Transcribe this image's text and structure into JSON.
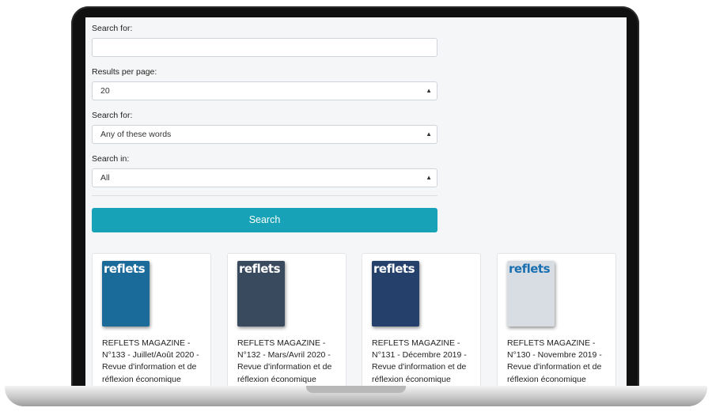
{
  "form": {
    "search_label": "Search for:",
    "search_value": "",
    "results_label": "Results per page:",
    "results_value": "20",
    "match_label": "Search for:",
    "match_value": "Any of these words",
    "scope_label": "Search in:",
    "scope_value": "All",
    "submit_label": "Search"
  },
  "results": [
    {
      "logo": "reflets",
      "title": "REFLETS MAGAZINE - N°133 - Juillet/Août 2020 - Revue d'information et de réflexion économique",
      "cover_color": "#1a6b9a"
    },
    {
      "logo": "reflets",
      "title": "REFLETS MAGAZINE - N°132 - Mars/Avril 2020 - Revue d'information et de réflexion économique",
      "cover_color": "#3a4a5e"
    },
    {
      "logo": "reflets",
      "title": "REFLETS MAGAZINE - N°131 - Décembre 2019 - Revue d'information et de réflexion économique",
      "cover_color": "#24406b"
    },
    {
      "logo": "reflets",
      "title": "REFLETS MAGAZINE - N°130 - Novembre 2019 - Revue d'information et de réflexion économique",
      "cover_color": "#d8dde3"
    }
  ]
}
